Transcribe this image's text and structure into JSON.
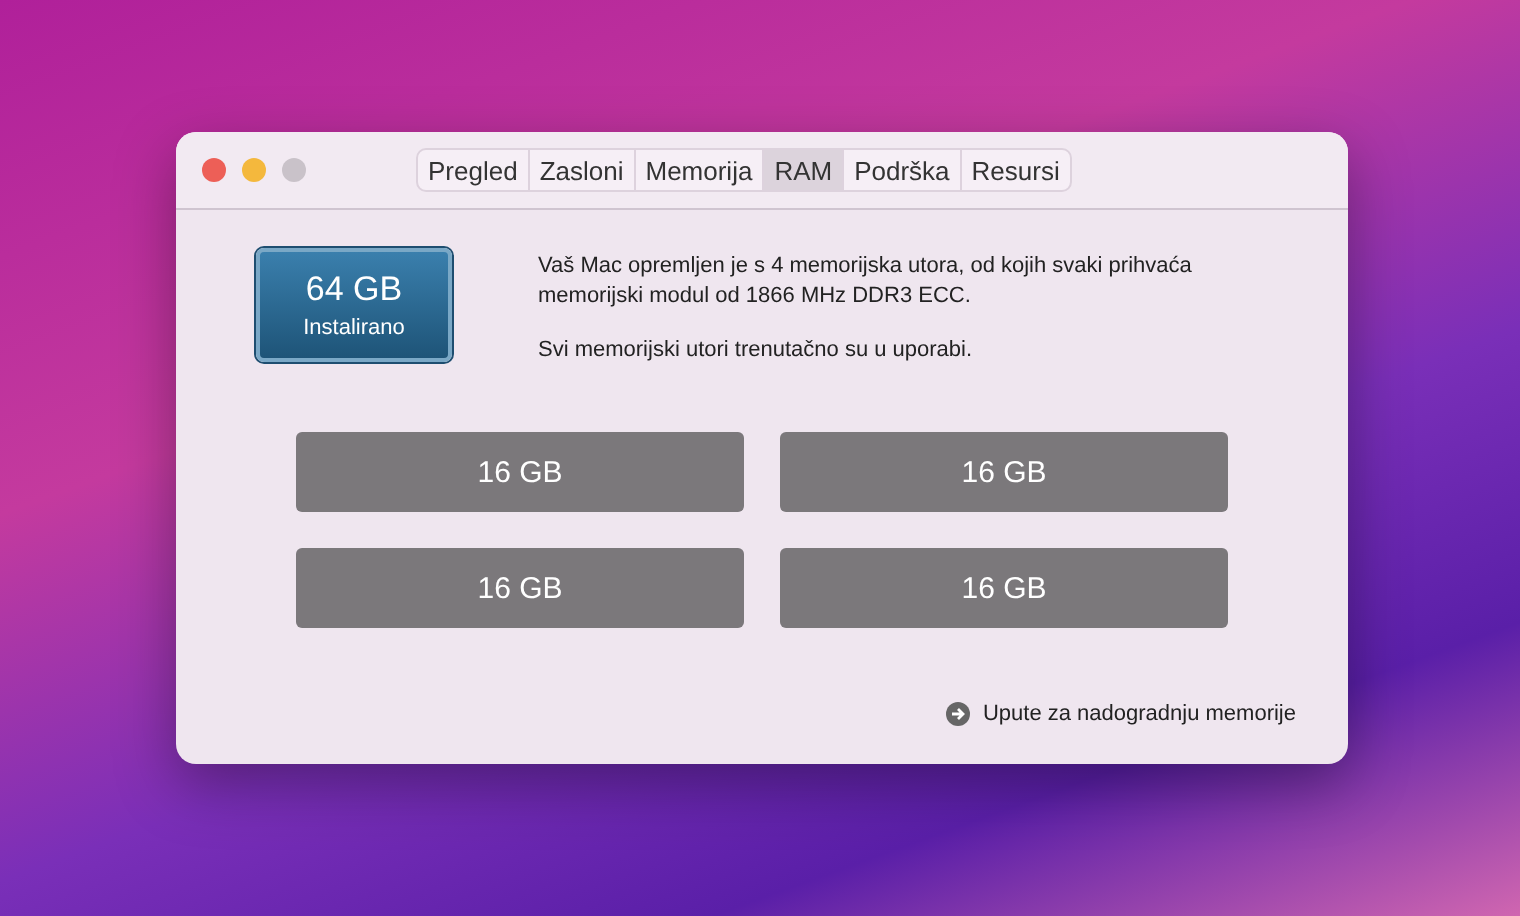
{
  "window": {
    "title_tabs": [
      {
        "label": "Pregled",
        "selected": false
      },
      {
        "label": "Zasloni",
        "selected": false
      },
      {
        "label": "Memorija",
        "selected": false
      },
      {
        "label": "RAM",
        "selected": true
      },
      {
        "label": "Podrška",
        "selected": false
      },
      {
        "label": "Resursi",
        "selected": false
      }
    ]
  },
  "memory_badge": {
    "size": "64 GB",
    "caption": "Instalirano"
  },
  "description": [
    "Vaš Mac opremljen je s 4 memorijska utora, od kojih svaki prihvaća memorijski modul od 1866 MHz DDR3 ECC.",
    "Svi memorijski utori trenutačno su u uporabi."
  ],
  "slots": [
    "16 GB",
    "16 GB",
    "16 GB",
    "16 GB"
  ],
  "upgrade_link": "Upute za nadogradnju memorije"
}
